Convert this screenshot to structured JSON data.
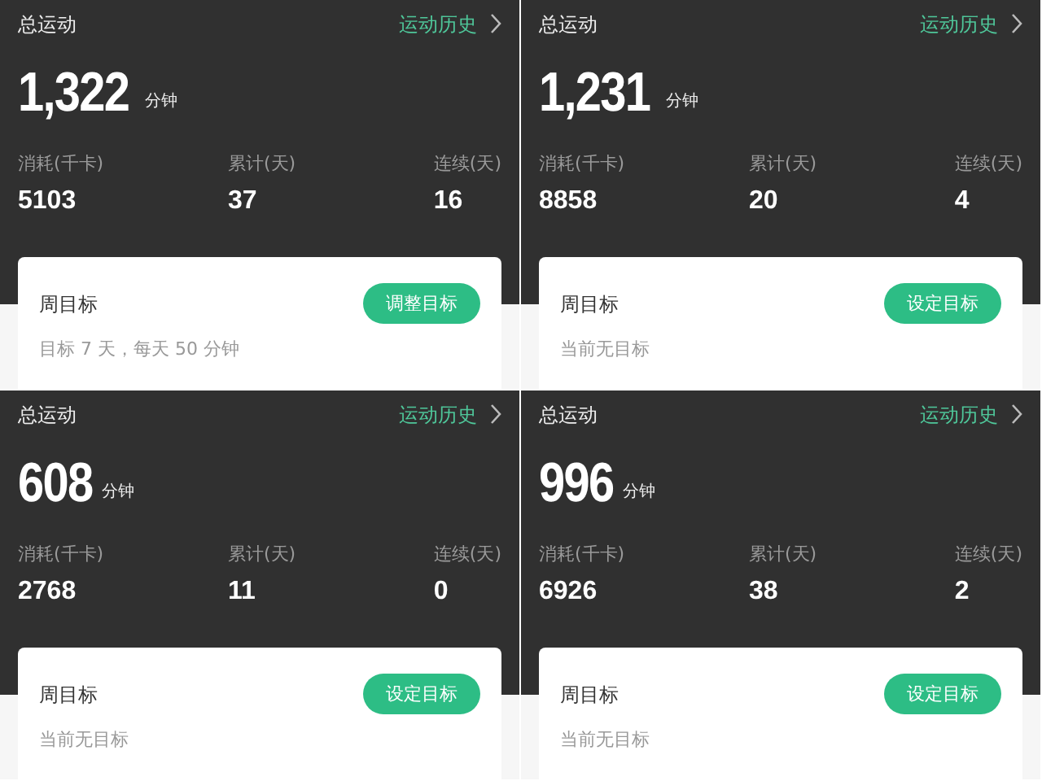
{
  "panels": [
    {
      "title": "总运动",
      "history_link": "运动历史",
      "total": "1,322",
      "unit": "分钟",
      "stats": [
        {
          "label": "消耗(千卡)",
          "value": "5103"
        },
        {
          "label": "累计(天)",
          "value": "37"
        },
        {
          "label": "连续(天)",
          "value": "16"
        }
      ],
      "goal": {
        "title": "周目标",
        "button": "调整目标",
        "note": "目标 7 天，每天 50 分钟"
      }
    },
    {
      "title": "总运动",
      "history_link": "运动历史",
      "total": "1,231",
      "unit": "分钟",
      "stats": [
        {
          "label": "消耗(千卡)",
          "value": "8858"
        },
        {
          "label": "累计(天)",
          "value": "20"
        },
        {
          "label": "连续(天)",
          "value": "4"
        }
      ],
      "goal": {
        "title": "周目标",
        "button": "设定目标",
        "note": "当前无目标"
      }
    },
    {
      "title": "总运动",
      "history_link": "运动历史",
      "total": "608",
      "unit": "分钟",
      "stats": [
        {
          "label": "消耗(千卡)",
          "value": "2768"
        },
        {
          "label": "累计(天)",
          "value": "11"
        },
        {
          "label": "连续(天)",
          "value": "0"
        }
      ],
      "goal": {
        "title": "周目标",
        "button": "设定目标",
        "note": "当前无目标"
      }
    },
    {
      "title": "总运动",
      "history_link": "运动历史",
      "total": "996",
      "unit": "分钟",
      "stats": [
        {
          "label": "消耗(千卡)",
          "value": "6926"
        },
        {
          "label": "累计(天)",
          "value": "38"
        },
        {
          "label": "连续(天)",
          "value": "2"
        }
      ],
      "goal": {
        "title": "周目标",
        "button": "设定目标",
        "note": "当前无目标"
      }
    }
  ]
}
